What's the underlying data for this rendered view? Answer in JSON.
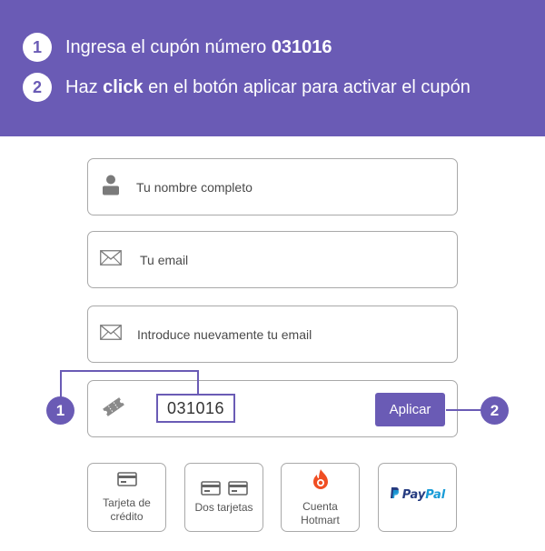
{
  "theme": {
    "accent": "#6a5bb5",
    "paypal_dark": "#253b80",
    "paypal_light": "#179bd7",
    "hotmart_orange": "#f04e23"
  },
  "instructions": [
    {
      "number": "1",
      "text_before": "Ingresa el cupón número ",
      "bold": "031016",
      "text_after": ""
    },
    {
      "number": "2",
      "text_before": "Haz ",
      "bold": "click",
      "text_after": " en el botón aplicar para activar el cupón"
    }
  ],
  "form": {
    "name_field": {
      "placeholder": "Tu nombre completo",
      "icon": "user-icon"
    },
    "email_field": {
      "placeholder": "Tu email",
      "icon": "envelope-icon"
    },
    "email_confirm_field": {
      "placeholder": "Introduce nuevamente tu email",
      "icon": "envelope-icon"
    },
    "coupon": {
      "icon": "ticket-icon",
      "code": "031016",
      "apply_label": "Aplicar"
    }
  },
  "markers": {
    "coupon_marker": "1",
    "apply_marker": "2"
  },
  "payment_options": [
    {
      "label": "Tarjeta de\ncrédito",
      "icon": "credit-card-icon"
    },
    {
      "label": "Dos tarjetas",
      "icon": "two-cards-icon"
    },
    {
      "label": "Cuenta\nHotmart",
      "icon": "hotmart-flame-icon"
    },
    {
      "label_pay": "Pay",
      "label_pal": "Pal",
      "icon": "paypal-icon"
    }
  ]
}
